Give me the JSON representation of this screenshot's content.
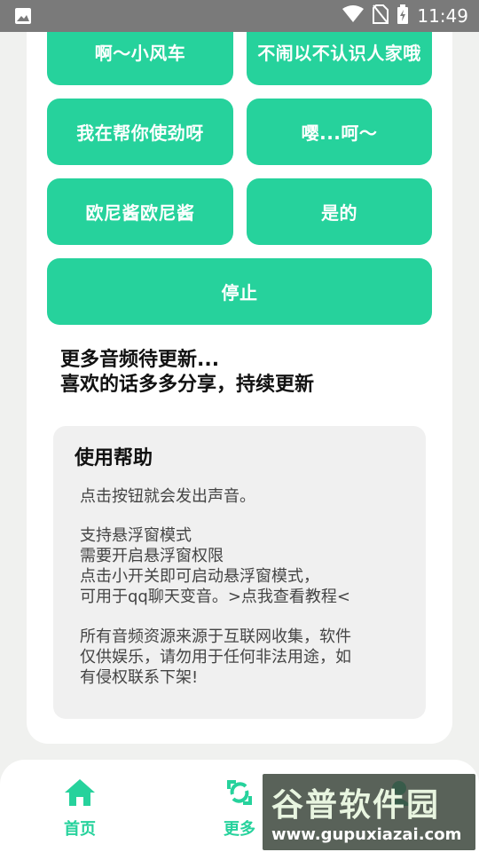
{
  "status_bar": {
    "time": "11:49",
    "icons": [
      "image-icon",
      "wifi-icon",
      "no-sim-icon",
      "battery-icon"
    ]
  },
  "sound_buttons": [
    {
      "label": "啊～小风车"
    },
    {
      "label": "不闹以不认识人家哦"
    },
    {
      "label": "我在帮你使劲呀"
    },
    {
      "label": "嘤...呵～"
    },
    {
      "label": "欧尼酱欧尼酱"
    },
    {
      "label": "是的"
    }
  ],
  "stop_button": {
    "label": "停止"
  },
  "notice": {
    "line1": "更多音频待更新...",
    "line2": "喜欢的话多多分享，持续更新"
  },
  "help": {
    "title": "使用帮助",
    "p1": "点击按钮就会发出声音。",
    "p2": "支持悬浮窗模式\n需要开启悬浮窗权限\n点击小开关即可启动悬浮窗模式，\n可用于qq聊天变音。>点我查看教程<",
    "p3": "所有音频资源来源于互联网收集，软件\n仅供娱乐，请勿用于任何非法用途，如\n有侵权联系下架!"
  },
  "nav": {
    "home": {
      "label": "首页",
      "icon": "home-icon"
    },
    "more": {
      "label": "更多",
      "icon": "refresh-icon"
    },
    "about": {
      "icon": "person-icon"
    }
  },
  "watermark": {
    "brand": "谷普软件园",
    "url": "www.gupuxiazai.com"
  },
  "colors": {
    "accent": "#26d29c",
    "statusbar": "#7a7a7a",
    "background": "#f0f1ef"
  }
}
